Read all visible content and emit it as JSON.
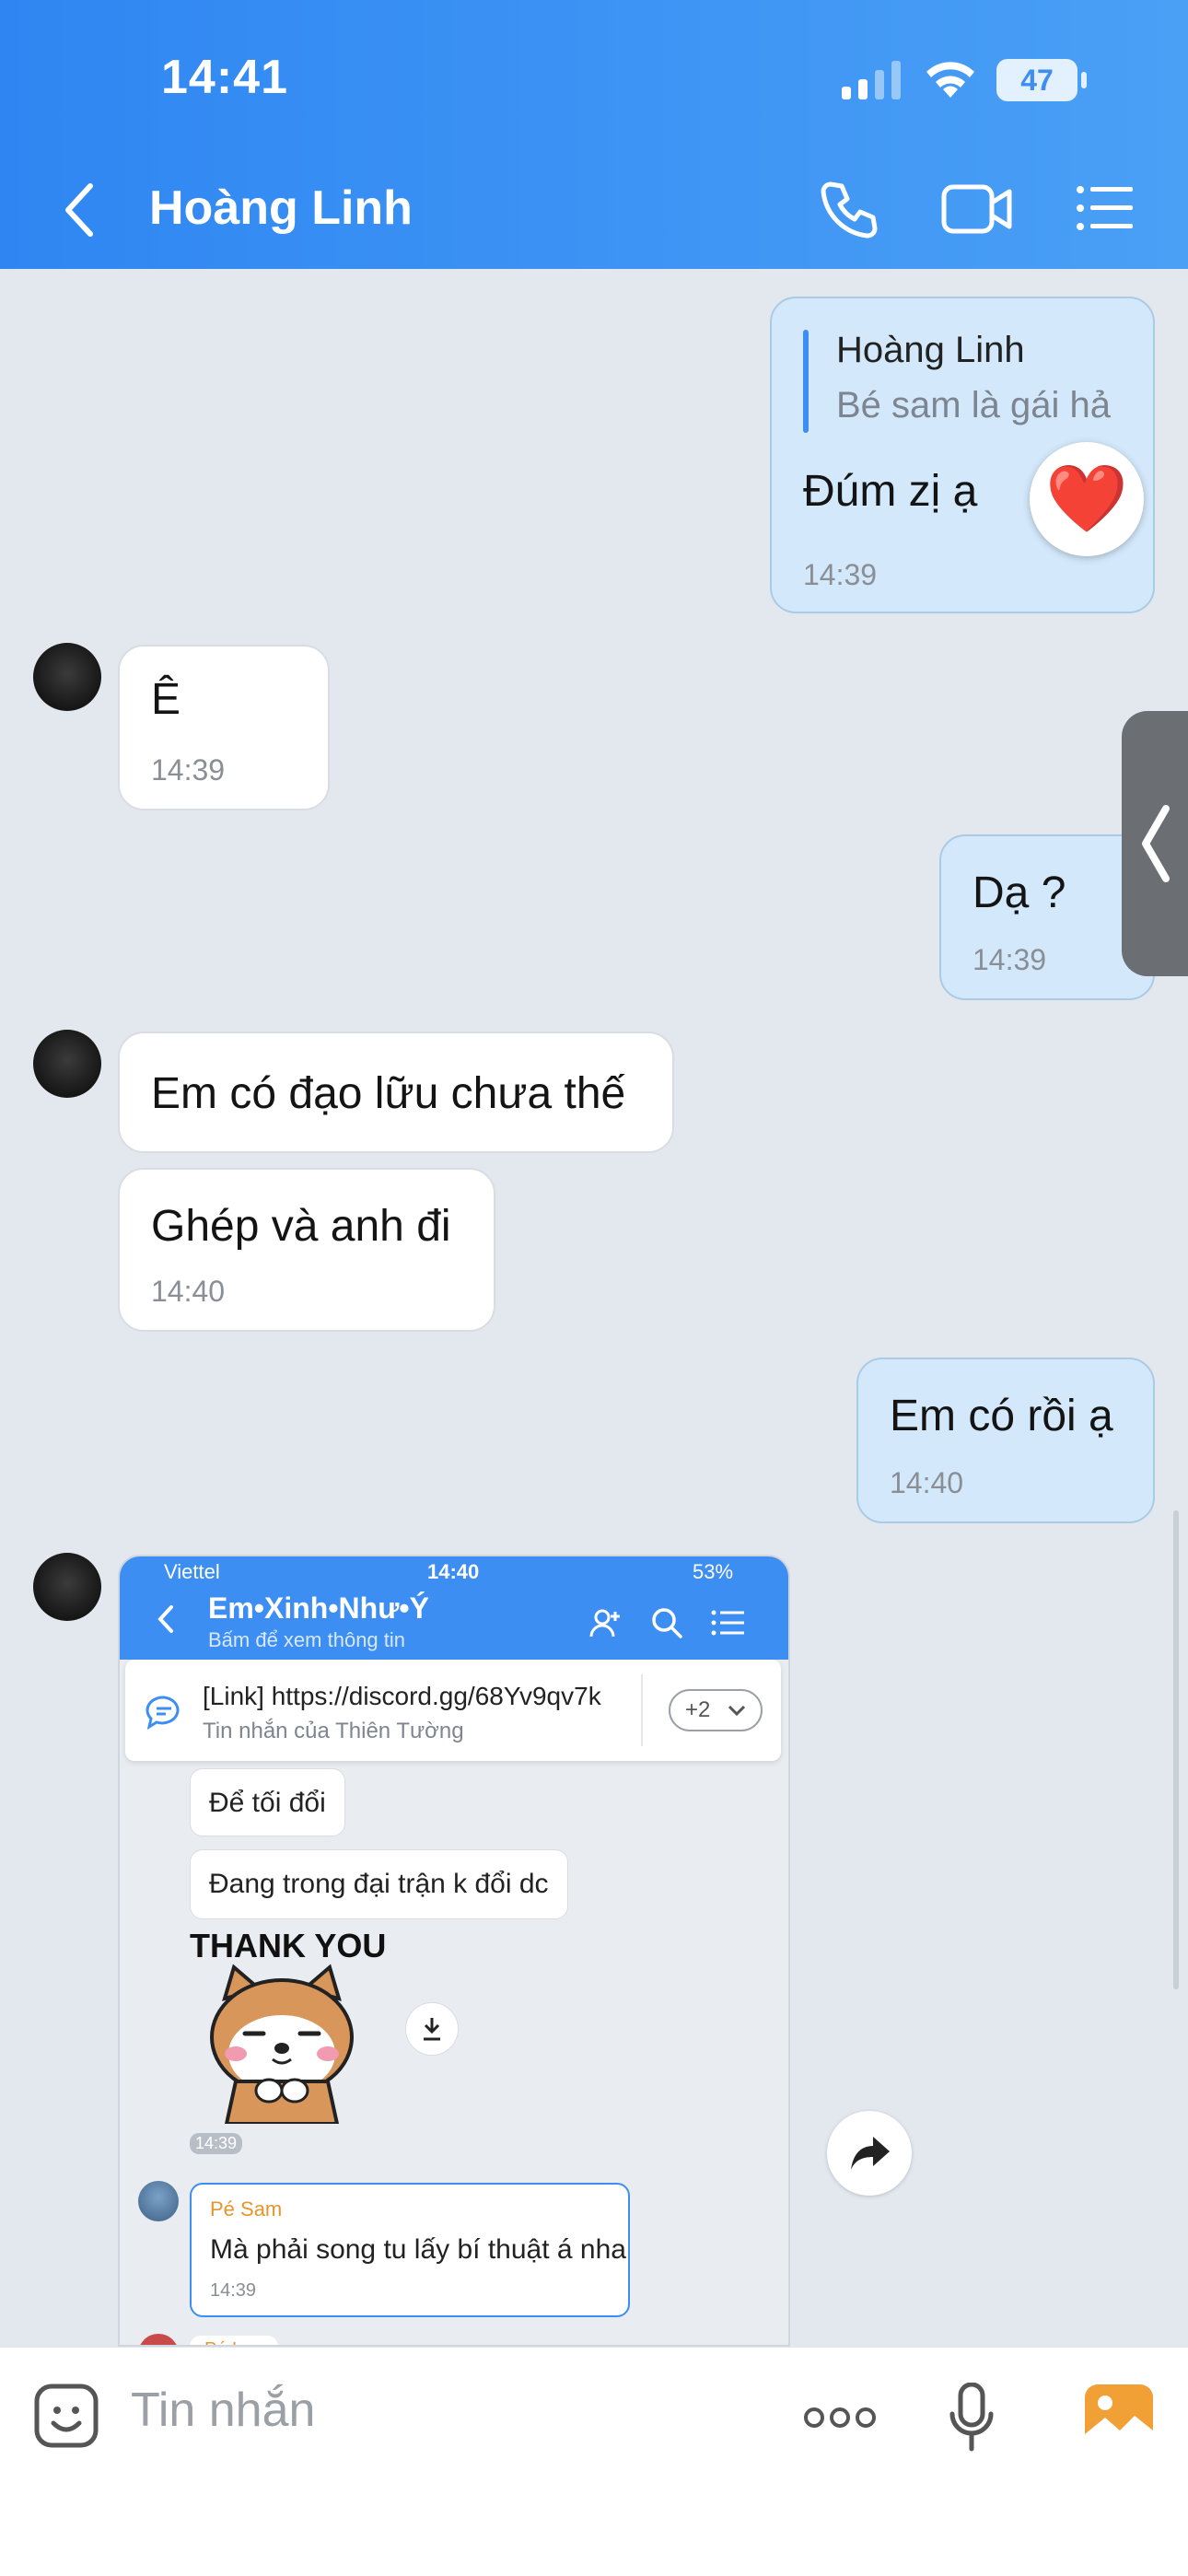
{
  "status_bar": {
    "time": "14:41",
    "battery": "47"
  },
  "header": {
    "title": "Hoàng Linh"
  },
  "messages": {
    "m1": {
      "quote_author": "Hoàng Linh",
      "quote_text": "Bé sam là gái hả",
      "text": "Đúm zị ạ",
      "time": "14:39",
      "reaction": "❤️"
    },
    "m2": {
      "text": "Ê",
      "time": "14:39"
    },
    "m3": {
      "text": "Dạ ?",
      "time": "14:39"
    },
    "m4": {
      "text": "Em có đạo lữu chưa thế"
    },
    "m5": {
      "text": "Ghép và anh đi",
      "time": "14:40"
    },
    "m6": {
      "text": "Em có rồi ạ",
      "time": "14:40"
    }
  },
  "forwarded_screenshot": {
    "carrier": "Viettel",
    "time": "14:40",
    "battery": "53%",
    "group_name": "Em•Xinh•Như•Ý",
    "group_sub": "Bấm để xem thông tin",
    "pinned_link": "[Link] https://discord.gg/68Yv9qv7k",
    "pinned_sub": "Tin nhắn của Thiên Tường",
    "pinned_more": "+2",
    "msg1": "Để tối đổi",
    "msg2": "Đang trong đại trận k đổi dc",
    "sticker_text": "THANK YOU",
    "sticker_time": "14:39",
    "reply_author": "Pé Sam",
    "reply_text": "Mà phải song tu lấy bí thuật á nha",
    "reply_time": "14:39",
    "partial_author": "Pé Ly"
  },
  "input": {
    "placeholder": "Tin nhắn"
  },
  "colors": {
    "header": "#2f86f2",
    "outgoing_bubble": "#d3e9fb",
    "incoming_bubble": "#ffffff",
    "background": "#e3e8ef"
  }
}
